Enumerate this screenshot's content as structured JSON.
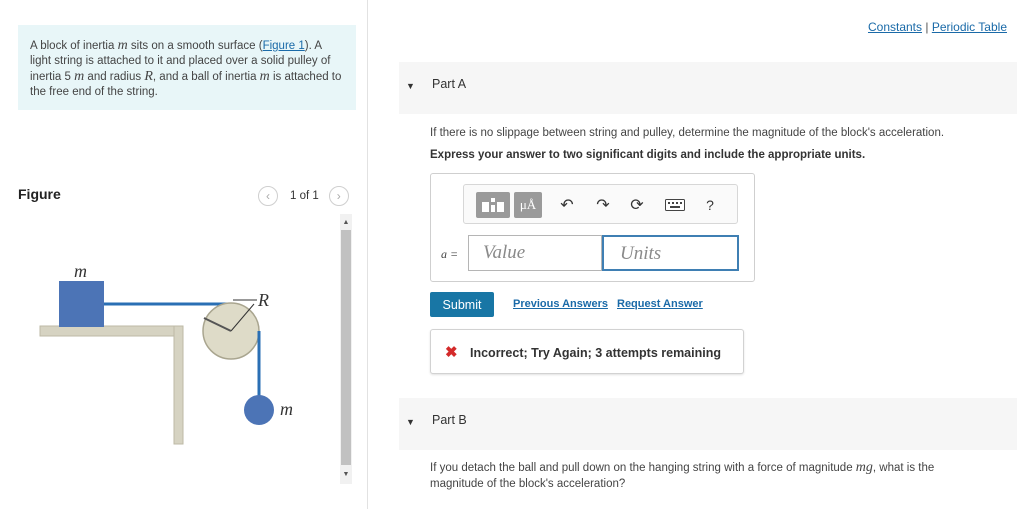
{
  "problem": {
    "intro_part1": "A block of inertia ",
    "var_m": "m",
    "intro_part2": " sits on a smooth surface (",
    "figure_link": "Figure 1",
    "intro_part3": "). A light string is attached to it and placed over a solid pulley of inertia 5 ",
    "intro_part4": " and radius ",
    "var_R": "R",
    "intro_part5": ", and a ball of inertia ",
    "intro_part6": " is attached to the free end of the string."
  },
  "figure": {
    "label": "Figure",
    "pager_text": "1 of 1",
    "prev_icon": "chevron-left-icon",
    "next_icon": "chevron-right-icon",
    "block_label": "m",
    "pulley_label": "R",
    "ball_label": "m",
    "colors": {
      "block": "#4c74b6",
      "string": "#2a6fb4",
      "table": "#d6d3c2",
      "pulley": "#dedbc8"
    }
  },
  "header_links": {
    "constants": "Constants",
    "separator": "|",
    "periodic_table": "Periodic Table"
  },
  "part_a": {
    "title": "Part A",
    "question": "If there is no slippage between string and pulley, determine the magnitude of the block's acceleration.",
    "instruction": "Express your answer to two significant digits and include the appropriate units.",
    "toolbar": {
      "templates_icon": "templates-icon",
      "units_label": "μÅ",
      "undo_icon": "undo-icon",
      "redo_icon": "redo-icon",
      "reset_icon": "reset-icon",
      "keyboard_icon": "keyboard-icon",
      "help_label": "?"
    },
    "variable_label": "a =",
    "value_placeholder": "Value",
    "units_placeholder": "Units",
    "submit_label": "Submit",
    "previous_answers": "Previous Answers",
    "request_answer": "Request Answer",
    "feedback": "Incorrect; Try Again; 3 attempts remaining"
  },
  "part_b": {
    "title": "Part B",
    "question_part1": "If you detach the ball and pull down on the hanging string with a force of magnitude ",
    "question_math": "mg",
    "question_part2": ", what is the magnitude of the block's acceleration?"
  }
}
